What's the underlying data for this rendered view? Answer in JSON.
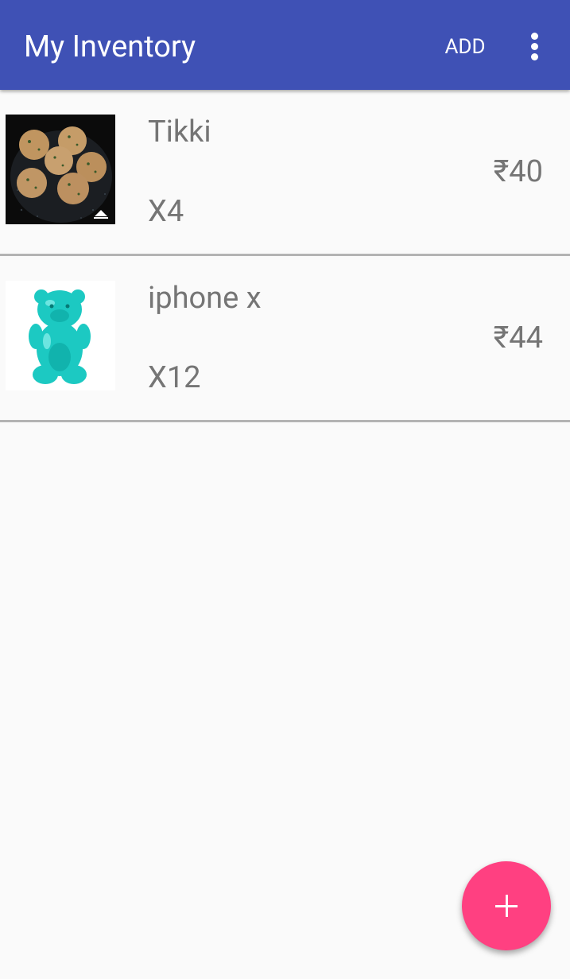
{
  "appbar": {
    "title": "My Inventory",
    "add_label": "ADD",
    "overflow_icon": "more-vert-icon",
    "color": "#3f51b5"
  },
  "items": [
    {
      "name": "Tikki",
      "quantity": "X4",
      "price": "₹40",
      "image": "tikki-photo"
    },
    {
      "name": "iphone x",
      "quantity": "X12",
      "price": "₹44",
      "image": "gummy-bear-photo"
    }
  ],
  "fab": {
    "icon": "plus-icon",
    "color": "#ff4081"
  }
}
